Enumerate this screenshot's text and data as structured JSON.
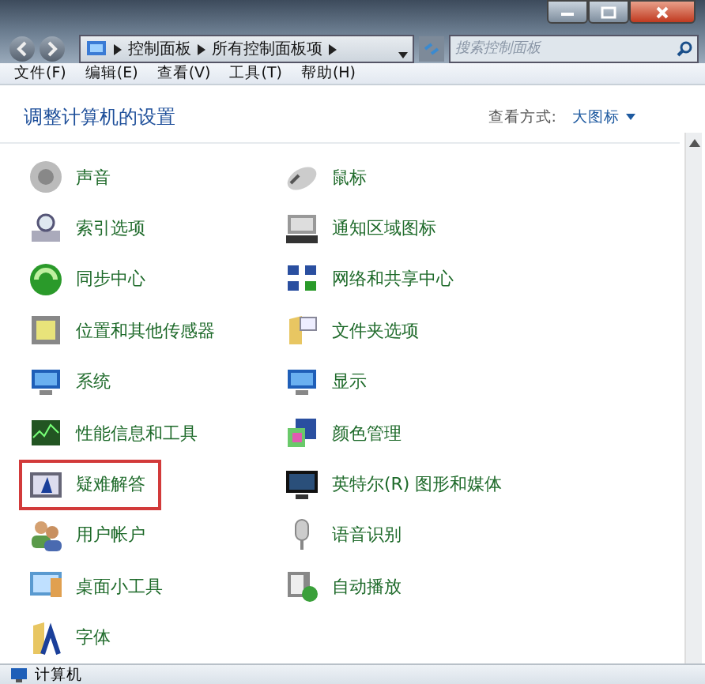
{
  "address_bar": {
    "crumbs": [
      "控制面板",
      "所有控制面板项"
    ]
  },
  "search": {
    "placeholder": "搜索控制面板"
  },
  "menu": [
    "文件(F)",
    "编辑(E)",
    "查看(V)",
    "工具(T)",
    "帮助(H)"
  ],
  "header": {
    "title": "调整计算机的设置",
    "view_label": "查看方式:",
    "view_value": "大图标"
  },
  "items": [
    {
      "label": "声音",
      "highlighted": false
    },
    {
      "label": "鼠标",
      "highlighted": false
    },
    {
      "label": "索引选项",
      "highlighted": false
    },
    {
      "label": "通知区域图标",
      "highlighted": false
    },
    {
      "label": "同步中心",
      "highlighted": false
    },
    {
      "label": "网络和共享中心",
      "highlighted": false
    },
    {
      "label": "位置和其他传感器",
      "highlighted": false
    },
    {
      "label": "文件夹选项",
      "highlighted": false
    },
    {
      "label": "系统",
      "highlighted": false
    },
    {
      "label": "显示",
      "highlighted": false
    },
    {
      "label": "性能信息和工具",
      "highlighted": false
    },
    {
      "label": "颜色管理",
      "highlighted": false
    },
    {
      "label": "疑难解答",
      "highlighted": true
    },
    {
      "label": "英特尔(R) 图形和媒体",
      "highlighted": false
    },
    {
      "label": "用户帐户",
      "highlighted": false
    },
    {
      "label": "语音识别",
      "highlighted": false
    },
    {
      "label": "桌面小工具",
      "highlighted": false
    },
    {
      "label": "自动播放",
      "highlighted": false
    },
    {
      "label": "字体",
      "highlighted": false
    }
  ],
  "status_bar": {
    "text": "计算机"
  }
}
